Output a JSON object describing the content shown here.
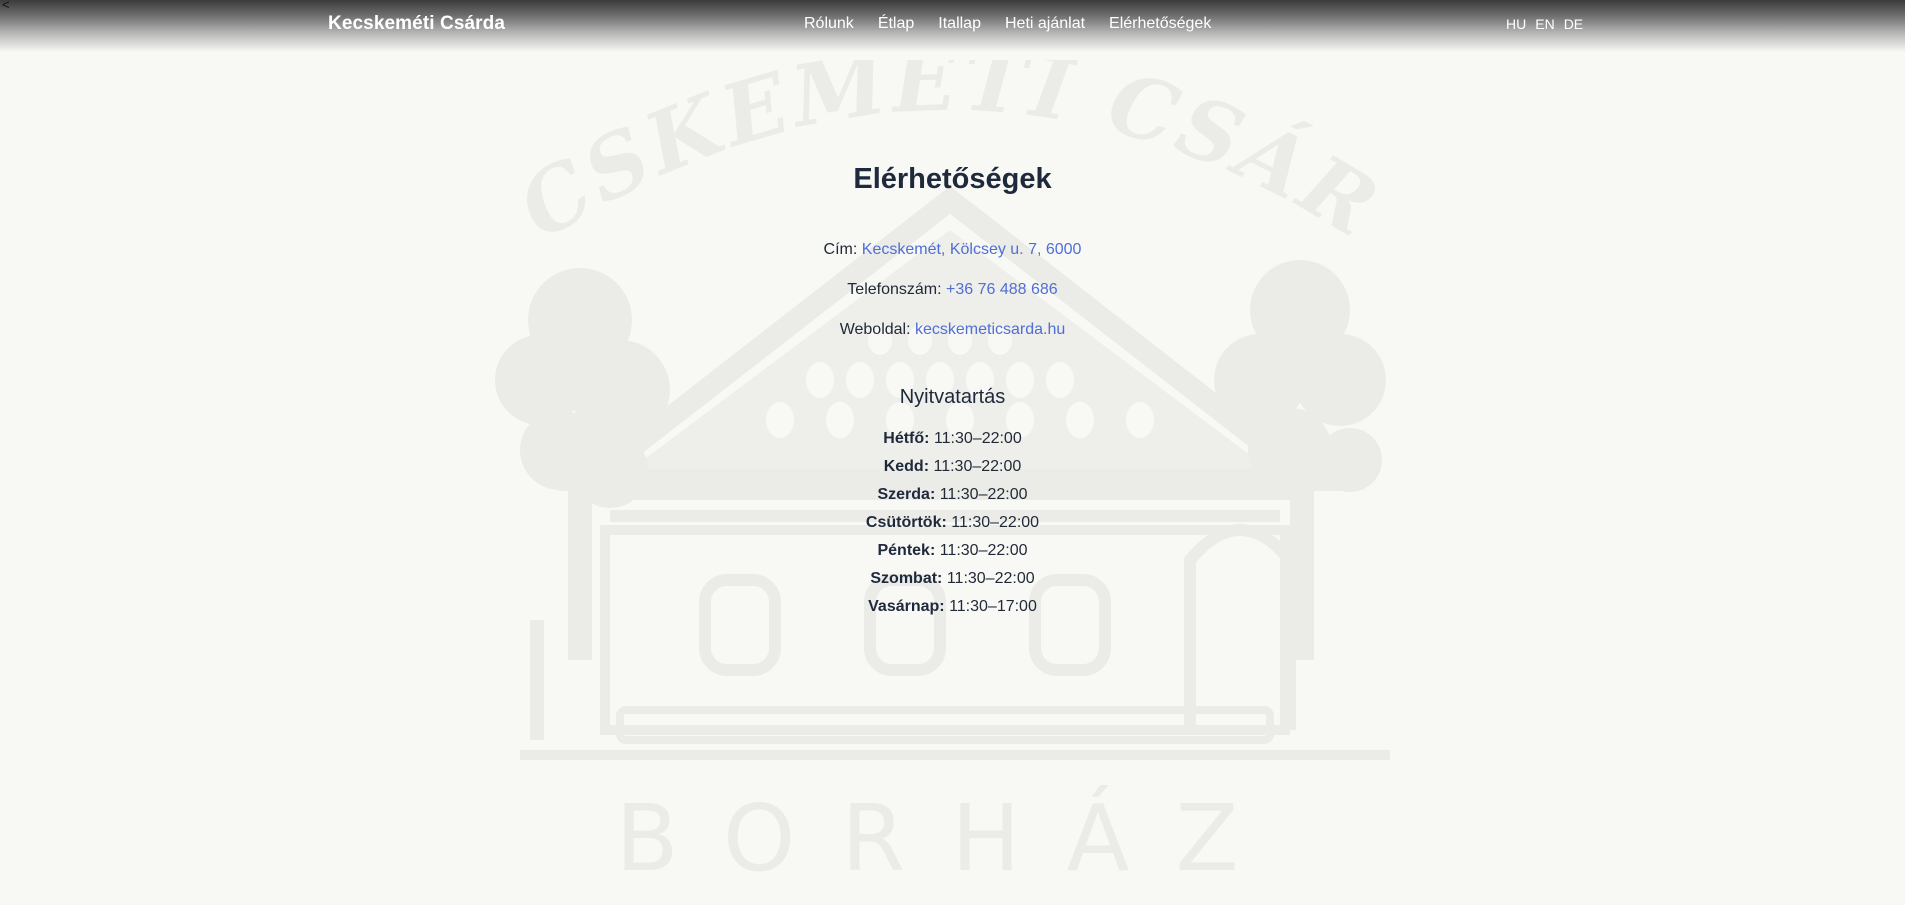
{
  "back": {
    "glyph": "<"
  },
  "header": {
    "brand": "Kecskeméti Csárda",
    "nav": [
      "Rólunk",
      "Étlap",
      "Itallap",
      "Heti ajánlat",
      "Elérhetőségek"
    ],
    "languages": [
      "HU",
      "EN",
      "DE"
    ]
  },
  "watermark": {
    "arc_text": "KECSKEMÉTI CSÁRDA",
    "bottom_text": "BORHÁZ"
  },
  "contact": {
    "title": "Elérhetőségek",
    "address_label": "Cím:",
    "address_value": "Kecskemét, Kölcsey u. 7, 6000",
    "phone_label": "Telefonszám:",
    "phone_value": "+36 76 488 686",
    "web_label": "Weboldal:",
    "web_value": "kecskemeticsarda.hu"
  },
  "hours": {
    "title": "Nyitvatartás",
    "days": [
      {
        "day": "Hétfő:",
        "time": "11:30–22:00"
      },
      {
        "day": "Kedd:",
        "time": "11:30–22:00"
      },
      {
        "day": "Szerda:",
        "time": "11:30–22:00"
      },
      {
        "day": "Csütörtök:",
        "time": "11:30–22:00"
      },
      {
        "day": "Péntek:",
        "time": "11:30–22:00"
      },
      {
        "day": "Szombat:",
        "time": "11:30–22:00"
      },
      {
        "day": "Vasárnap:",
        "time": "11:30–17:00"
      }
    ]
  },
  "colors": {
    "background": "#f8f8f5",
    "link": "#4f6fd6",
    "heading": "#1e293b",
    "watermark": "#ecece8"
  }
}
